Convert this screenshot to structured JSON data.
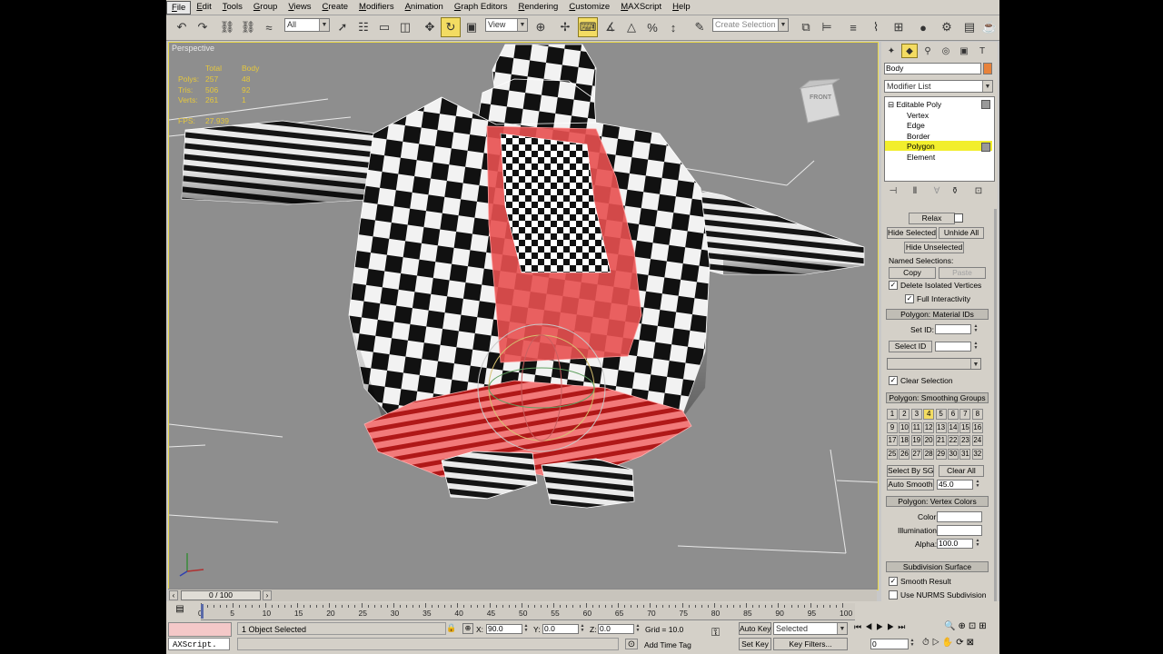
{
  "menu": [
    "File",
    "Edit",
    "Tools",
    "Group",
    "Views",
    "Create",
    "Modifiers",
    "Animation",
    "Graph Editors",
    "Rendering",
    "Customize",
    "MAXScript",
    "Help"
  ],
  "toolbar": {
    "filter_value": "All",
    "refcoord_value": "View",
    "selection_set_placeholder": "Create Selection Set"
  },
  "viewport": {
    "label": "Perspective",
    "viewcube_face": "FRONT",
    "stats_headers": [
      "Total",
      "Body"
    ],
    "stats": [
      {
        "label": "Polys:",
        "total": "257",
        "body": "48"
      },
      {
        "label": "Tris:",
        "total": "506",
        "body": "92"
      },
      {
        "label": "Verts:",
        "total": "261",
        "body": "1"
      }
    ],
    "fps_label": "FPS:",
    "fps_value": "27.939"
  },
  "panel": {
    "object_name": "Body",
    "modifier_list": "Modifier List",
    "stack": [
      "Editable Poly",
      "Vertex",
      "Edge",
      "Border",
      "Polygon",
      "Element"
    ],
    "selected_stack_item": "Polygon",
    "relax_label": "Relax",
    "hide_selected": "Hide Selected",
    "unhide_all": "Unhide All",
    "hide_unselected": "Hide Unselected",
    "named_selections": "Named Selections:",
    "copy": "Copy",
    "paste": "Paste",
    "delete_isolated": "Delete Isolated Vertices",
    "full_interactivity": "Full Interactivity",
    "material_ids_title": "Polygon: Material IDs",
    "set_id": "Set ID:",
    "select_id": "Select ID",
    "clear_selection": "Clear Selection",
    "smoothing_title": "Polygon: Smoothing Groups",
    "smoothing_groups": [
      "1",
      "2",
      "3",
      "4",
      "5",
      "6",
      "7",
      "8",
      "9",
      "10",
      "11",
      "12",
      "13",
      "14",
      "15",
      "16",
      "17",
      "18",
      "19",
      "20",
      "21",
      "22",
      "23",
      "24",
      "25",
      "26",
      "27",
      "28",
      "29",
      "30",
      "31",
      "32"
    ],
    "active_group": "4",
    "select_by_sg": "Select By SG",
    "clear_all": "Clear All",
    "auto_smooth": "Auto Smooth",
    "auto_smooth_value": "45.0",
    "vertex_colors_title": "Polygon: Vertex Colors",
    "color_label": "Color:",
    "illumination_label": "Illumination:",
    "alpha_label": "Alpha:",
    "alpha_value": "100.0",
    "subdivision_title": "Subdivision Surface",
    "smooth_result": "Smooth Result",
    "use_nurms": "Use NURMS Subdivision"
  },
  "timeline": {
    "slider_label": "0 / 100",
    "ticks": [
      "0",
      "5",
      "10",
      "15",
      "20",
      "25",
      "30",
      "35",
      "40",
      "45",
      "50",
      "55",
      "60",
      "65",
      "70",
      "75",
      "80",
      "85",
      "90",
      "95",
      "100"
    ]
  },
  "status": {
    "selected_text": "1 Object Selected",
    "x_label": "X:",
    "x_value": "90.0",
    "y_label": "Y:",
    "y_value": "0.0",
    "z_label": "Z:",
    "z_value": "0.0",
    "grid": "Grid = 10.0",
    "add_time_tag": "Add Time Tag",
    "maxscript": "AXScript.",
    "auto_key": "Auto Key",
    "set_key": "Set Key",
    "key_mode": "Selected",
    "key_filters": "Key Filters...",
    "frame_value": "0"
  },
  "colors": {
    "viewport_bg": "#8e8e8e",
    "selection_red": "#e84a4a",
    "highlight_yellow": "#f3dc62",
    "stats_yellow": "#e6c83c"
  }
}
